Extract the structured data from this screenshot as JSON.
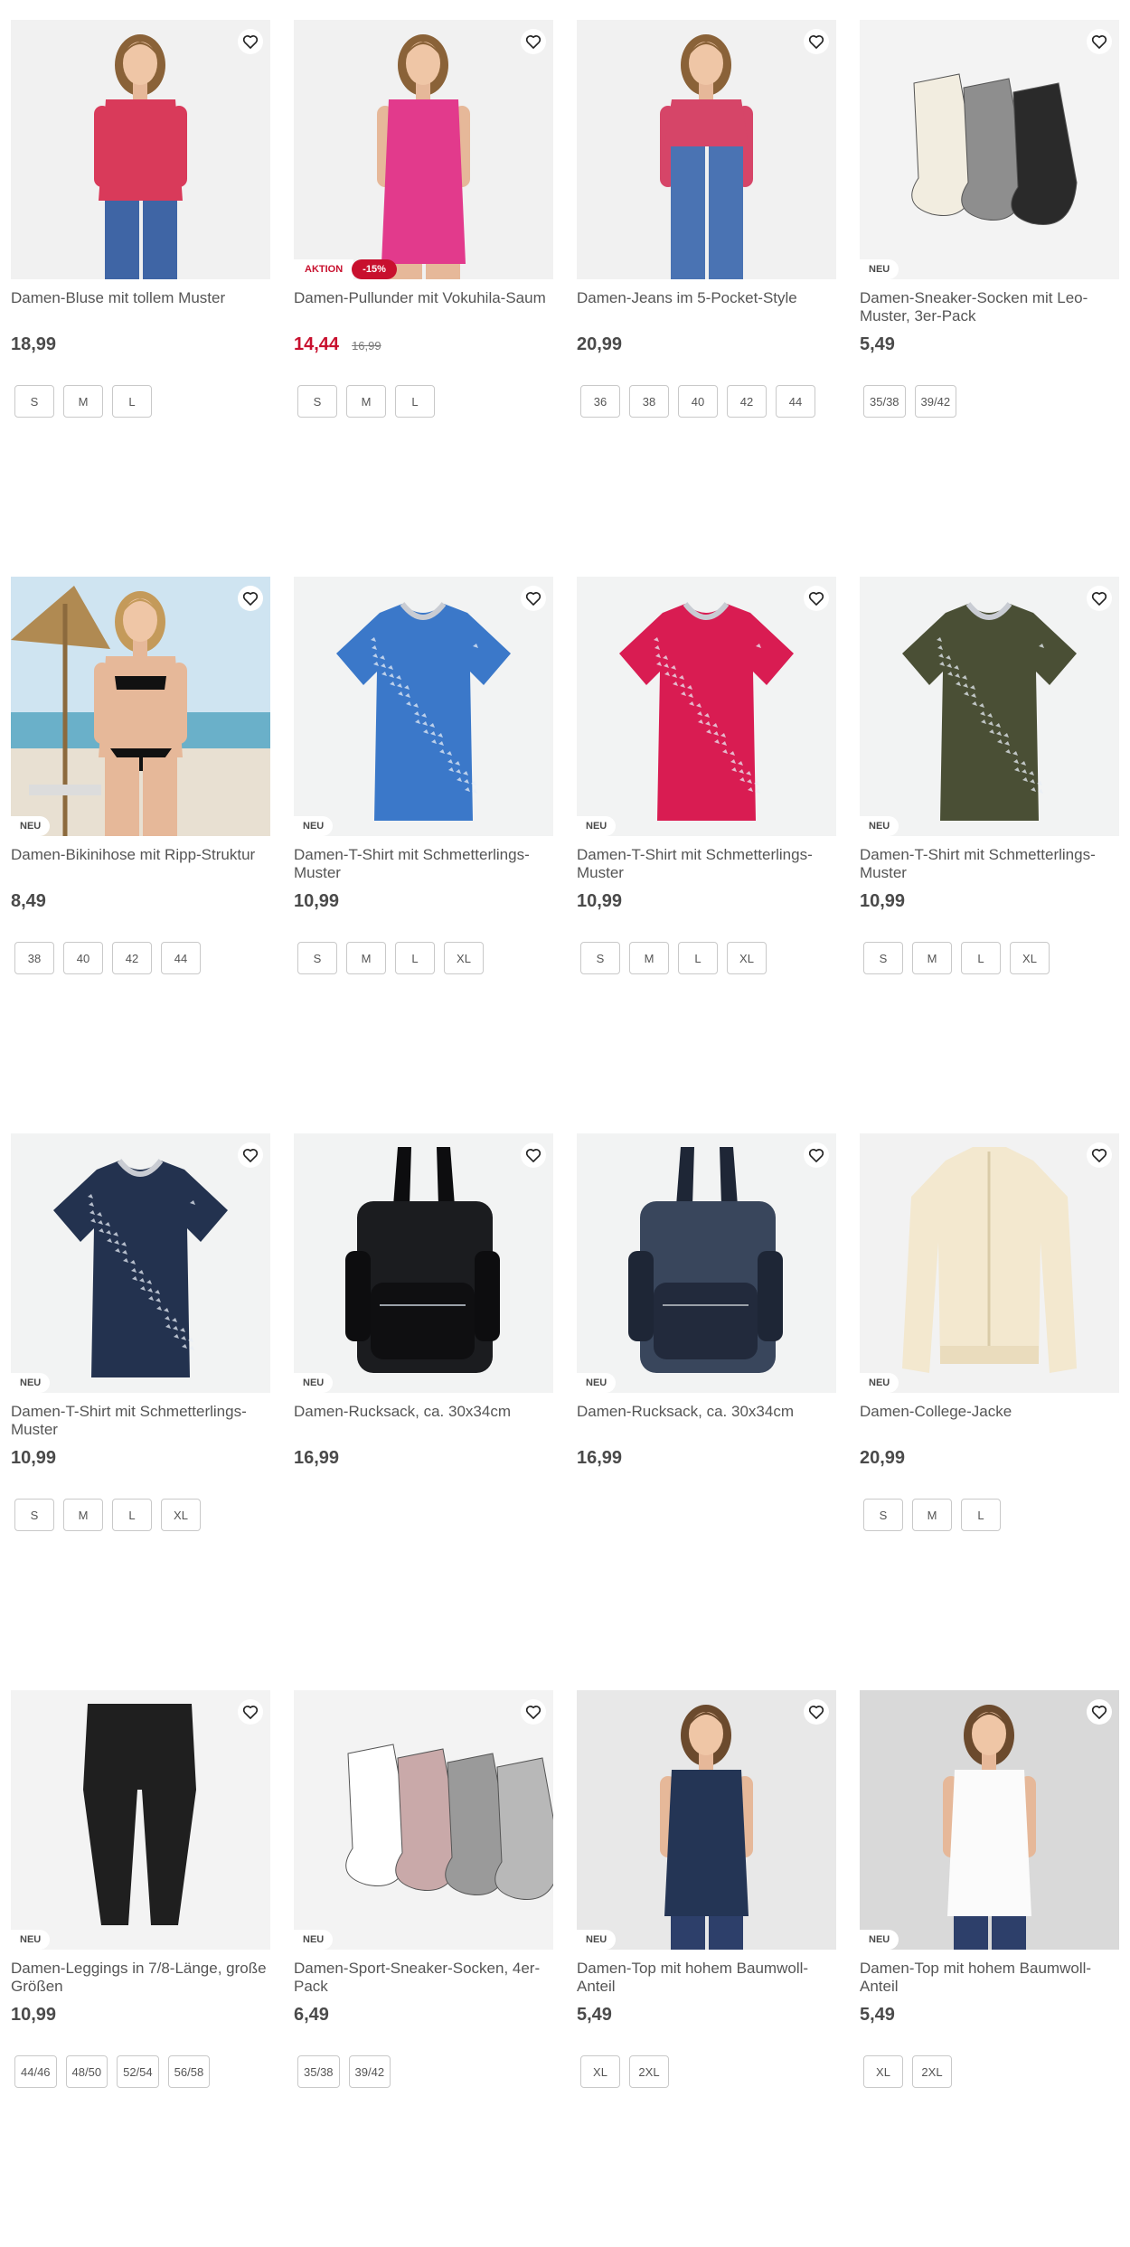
{
  "colors": {
    "sale_red": "#c8102e",
    "badge_bg": "#ffffff",
    "text": "#4a4a4a"
  },
  "products": [
    {
      "title": "Damen-Bluse mit tollem Muster",
      "price": "18,99",
      "old_price": "",
      "badge": "",
      "sale_label": "",
      "discount": "",
      "sizes": [
        "S",
        "M",
        "L"
      ],
      "image": "model-red-blouse"
    },
    {
      "title": "Damen-Pullunder mit Vokuhila-Saum",
      "price": "14,44",
      "old_price": "16,99",
      "badge": "",
      "sale_label": "AKTION",
      "discount": "-15%",
      "sizes": [
        "S",
        "M",
        "L"
      ],
      "image": "model-pink-vest"
    },
    {
      "title": "Damen-Jeans im 5-Pocket-Style",
      "price": "20,99",
      "old_price": "",
      "badge": "",
      "sale_label": "",
      "discount": "",
      "sizes": [
        "36",
        "38",
        "40",
        "42",
        "44"
      ],
      "image": "model-jeans"
    },
    {
      "title": "Damen-Sneaker-Socken mit Leo-Muster, 3er-Pack",
      "price": "5,49",
      "old_price": "",
      "badge": "NEU",
      "sale_label": "",
      "discount": "",
      "sizes": [
        "35/38",
        "39/42"
      ],
      "image": "leo-socks"
    },
    {
      "title": "Damen-Bikinihose mit Ripp-Struktur",
      "price": "8,49",
      "old_price": "",
      "badge": "NEU",
      "sale_label": "",
      "discount": "",
      "sizes": [
        "38",
        "40",
        "42",
        "44"
      ],
      "image": "model-bikini-beach"
    },
    {
      "title": "Damen-T-Shirt mit Schmetterlings-Muster",
      "price": "10,99",
      "old_price": "",
      "badge": "NEU",
      "sale_label": "",
      "discount": "",
      "sizes": [
        "S",
        "M",
        "L",
        "XL"
      ],
      "image": "tshirt-blue"
    },
    {
      "title": "Damen-T-Shirt mit Schmetterlings-Muster",
      "price": "10,99",
      "old_price": "",
      "badge": "NEU",
      "sale_label": "",
      "discount": "",
      "sizes": [
        "S",
        "M",
        "L",
        "XL"
      ],
      "image": "tshirt-pink"
    },
    {
      "title": "Damen-T-Shirt mit Schmetterlings-Muster",
      "price": "10,99",
      "old_price": "",
      "badge": "NEU",
      "sale_label": "",
      "discount": "",
      "sizes": [
        "S",
        "M",
        "L",
        "XL"
      ],
      "image": "tshirt-olive"
    },
    {
      "title": "Damen-T-Shirt mit Schmetterlings-Muster",
      "price": "10,99",
      "old_price": "",
      "badge": "NEU",
      "sale_label": "",
      "discount": "",
      "sizes": [
        "S",
        "M",
        "L",
        "XL"
      ],
      "image": "tshirt-navy"
    },
    {
      "title": "Damen-Rucksack, ca. 30x34cm",
      "price": "16,99",
      "old_price": "",
      "badge": "NEU",
      "sale_label": "",
      "discount": "",
      "sizes": [],
      "image": "backpack-black"
    },
    {
      "title": "Damen-Rucksack, ca. 30x34cm",
      "price": "16,99",
      "old_price": "",
      "badge": "NEU",
      "sale_label": "",
      "discount": "",
      "sizes": [],
      "image": "backpack-navy"
    },
    {
      "title": "Damen-College-Jacke",
      "price": "20,99",
      "old_price": "",
      "badge": "NEU",
      "sale_label": "",
      "discount": "",
      "sizes": [
        "S",
        "M",
        "L"
      ],
      "image": "jacket-cream"
    },
    {
      "title": "Damen-Leggings in 7/8-Länge, große Größen",
      "price": "10,99",
      "old_price": "",
      "badge": "NEU",
      "sale_label": "",
      "discount": "",
      "sizes": [
        "44/46",
        "48/50",
        "52/54",
        "56/58"
      ],
      "image": "leggings-black"
    },
    {
      "title": "Damen-Sport-Sneaker-Socken, 4er-Pack",
      "price": "6,49",
      "old_price": "",
      "badge": "NEU",
      "sale_label": "",
      "discount": "",
      "sizes": [
        "35/38",
        "39/42"
      ],
      "image": "sport-socks"
    },
    {
      "title": "Damen-Top mit hohem Baumwoll-Anteil",
      "price": "5,49",
      "old_price": "",
      "badge": "NEU",
      "sale_label": "",
      "discount": "",
      "sizes": [
        "XL",
        "2XL"
      ],
      "image": "model-navy-top"
    },
    {
      "title": "Damen-Top mit hohem Baumwoll-Anteil",
      "price": "5,49",
      "old_price": "",
      "badge": "NEU",
      "sale_label": "",
      "discount": "",
      "sizes": [
        "XL",
        "2XL"
      ],
      "image": "model-white-top"
    }
  ]
}
